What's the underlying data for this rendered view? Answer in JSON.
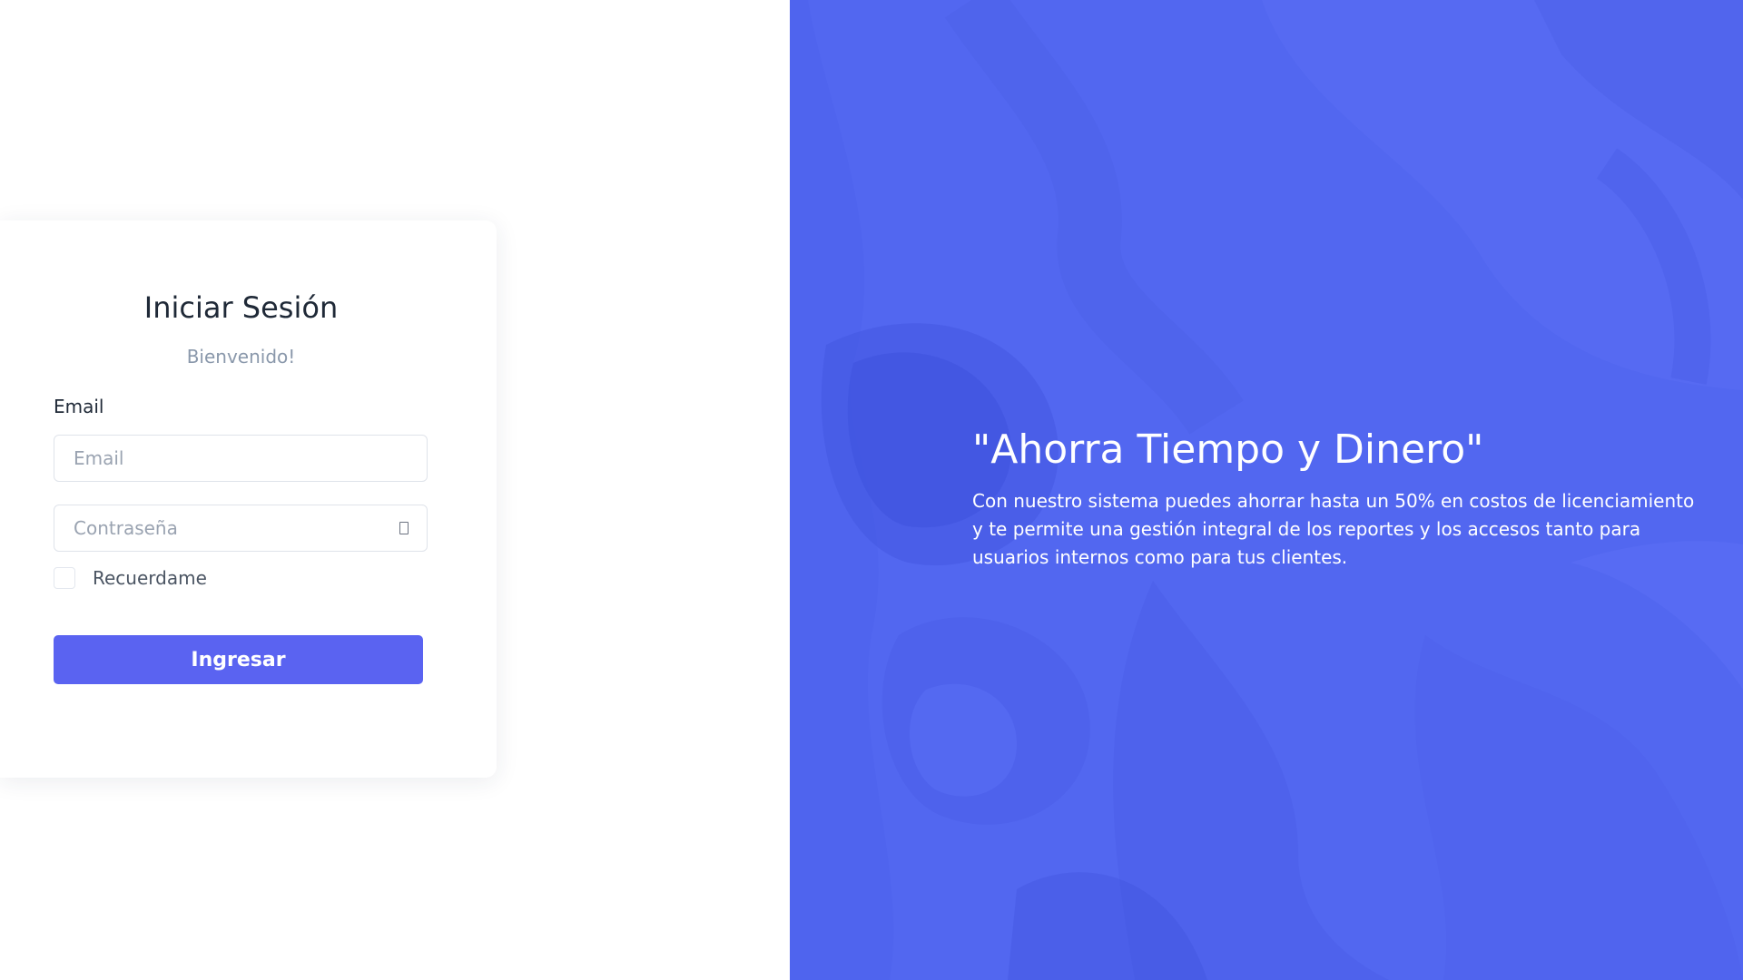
{
  "login": {
    "title": "Iniciar Sesión",
    "subtitle": "Bienvenido!",
    "email_label": "Email",
    "email_placeholder": "Email",
    "email_value": "",
    "password_placeholder": "Contraseña",
    "password_value": "",
    "remember_label": "Recuerdame",
    "remember_checked": false,
    "submit_label": "Ingresar"
  },
  "promo": {
    "headline": "\"Ahorra Tiempo y Dinero\"",
    "description": "Con nuestro sistema puedes ahorrar hasta un 50% en costos de licenciamiento y te permite una gestión integral de los reportes y los accesos tanto para usuarios internos como para tus clientes."
  },
  "colors": {
    "accent": "#5a63f1",
    "panel_background": "#5267f0",
    "title_text": "#1f2937",
    "muted_text": "#8a98ab"
  },
  "icons": {
    "password_toggle": "eye-icon"
  }
}
